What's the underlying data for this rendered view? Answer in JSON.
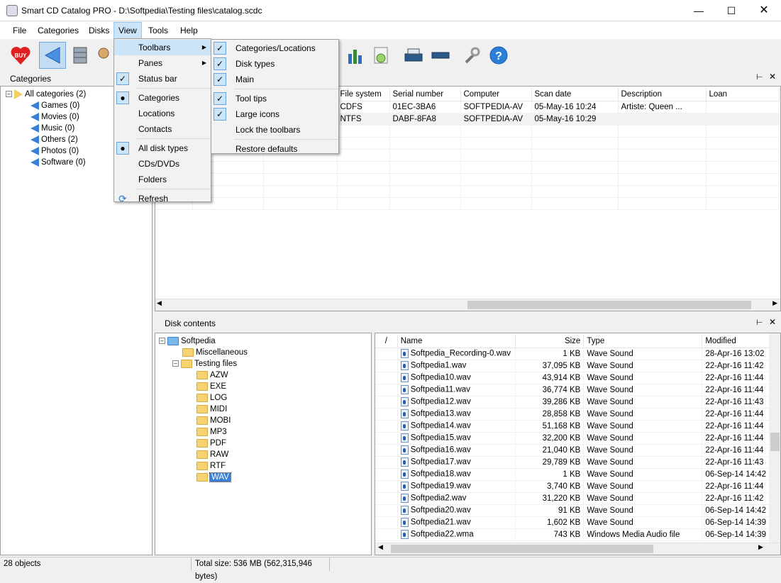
{
  "window": {
    "title": "Smart CD Catalog PRO - D:\\Softpedia\\Testing files\\catalog.scdc"
  },
  "menubar": [
    "File",
    "Categories",
    "Disks",
    "View",
    "Tools",
    "Help"
  ],
  "categories_panel": {
    "title": "Categories",
    "root": "All categories (2)",
    "items": [
      "Games (0)",
      "Movies (0)",
      "Music (0)",
      "Others (2)",
      "Photos (0)",
      "Software (0)"
    ]
  },
  "disks_table": {
    "columns": [
      "File system",
      "Serial number",
      "Computer",
      "Scan date",
      "Description",
      "Loan"
    ],
    "rows": [
      [
        "CDFS",
        "01EC-3BA6",
        "SOFTPEDIA-AV",
        "05-May-16 10:24",
        "Artiste: Queen ...",
        ""
      ],
      [
        "NTFS",
        "DABF-8FA8",
        "SOFTPEDIA-AV",
        "05-May-16 10:29",
        "",
        ""
      ]
    ]
  },
  "disk_contents": {
    "title": "Disk contents",
    "tree": {
      "root": "Softpedia",
      "children": [
        "Miscellaneous",
        "Testing files"
      ],
      "testing_files": [
        "AZW",
        "EXE",
        "LOG",
        "MIDI",
        "MOBI",
        "MP3",
        "PDF",
        "RAW",
        "RTF",
        "WAV"
      ],
      "selected": "WAV"
    },
    "sort_indicator": "/",
    "columns": [
      "Name",
      "Size",
      "Type",
      "Modified"
    ],
    "files": [
      [
        "Softpedia_Recording-0.wav",
        "1 KB",
        "Wave Sound",
        "28-Apr-16 13:02"
      ],
      [
        "Softpedia1.wav",
        "37,095 KB",
        "Wave Sound",
        "22-Apr-16 11:42"
      ],
      [
        "Softpedia10.wav",
        "43,914 KB",
        "Wave Sound",
        "22-Apr-16 11:44"
      ],
      [
        "Softpedia11.wav",
        "36,774 KB",
        "Wave Sound",
        "22-Apr-16 11:44"
      ],
      [
        "Softpedia12.wav",
        "39,286 KB",
        "Wave Sound",
        "22-Apr-16 11:43"
      ],
      [
        "Softpedia13.wav",
        "28,858 KB",
        "Wave Sound",
        "22-Apr-16 11:44"
      ],
      [
        "Softpedia14.wav",
        "51,168 KB",
        "Wave Sound",
        "22-Apr-16 11:44"
      ],
      [
        "Softpedia15.wav",
        "32,200 KB",
        "Wave Sound",
        "22-Apr-16 11:44"
      ],
      [
        "Softpedia16.wav",
        "21,040 KB",
        "Wave Sound",
        "22-Apr-16 11:44"
      ],
      [
        "Softpedia17.wav",
        "29,789 KB",
        "Wave Sound",
        "22-Apr-16 11:43"
      ],
      [
        "Softpedia18.wav",
        "1 KB",
        "Wave Sound",
        "06-Sep-14 14:42"
      ],
      [
        "Softpedia19.wav",
        "3,740 KB",
        "Wave Sound",
        "22-Apr-16 11:44"
      ],
      [
        "Softpedia2.wav",
        "31,220 KB",
        "Wave Sound",
        "22-Apr-16 11:42"
      ],
      [
        "Softpedia20.wav",
        "91 KB",
        "Wave Sound",
        "06-Sep-14 14:42"
      ],
      [
        "Softpedia21.wav",
        "1,602 KB",
        "Wave Sound",
        "06-Sep-14 14:39"
      ],
      [
        "Softpedia22.wma",
        "743 KB",
        "Windows Media Audio file",
        "06-Sep-14 14:39"
      ]
    ]
  },
  "view_menu": {
    "items": [
      {
        "label": "Toolbars",
        "type": "submenu",
        "highlighted": true
      },
      {
        "label": "Panes",
        "type": "submenu"
      },
      {
        "label": "Status bar",
        "type": "check",
        "checked": true
      },
      {
        "sep": true
      },
      {
        "label": "Categories",
        "type": "radio",
        "checked": true
      },
      {
        "label": "Locations",
        "type": "radio"
      },
      {
        "label": "Contacts",
        "type": "radio"
      },
      {
        "sep": true
      },
      {
        "label": "All disk types",
        "type": "radio",
        "checked": true
      },
      {
        "label": "CDs/DVDs",
        "type": "radio"
      },
      {
        "label": "Folders",
        "type": "radio"
      },
      {
        "sep": true
      },
      {
        "label": "Refresh",
        "type": "icon"
      }
    ]
  },
  "toolbars_submenu": {
    "items": [
      {
        "label": "Categories/Locations",
        "checked": true
      },
      {
        "label": "Disk types",
        "checked": true
      },
      {
        "label": "Main",
        "checked": true
      },
      {
        "sep": true
      },
      {
        "label": "Tool tips",
        "checked": true
      },
      {
        "label": "Large icons",
        "checked": true
      },
      {
        "label": "Lock the toolbars",
        "checked": false
      },
      {
        "sep": true
      },
      {
        "label": "Restore defaults",
        "checked": false
      }
    ]
  },
  "statusbar": {
    "objects": "28 objects",
    "total": "Total size: 536 MB (562,315,946 bytes)"
  },
  "colors": {
    "accent": "#3a7fd8",
    "highlight": "#cce4f7",
    "buy": "#e02020"
  }
}
